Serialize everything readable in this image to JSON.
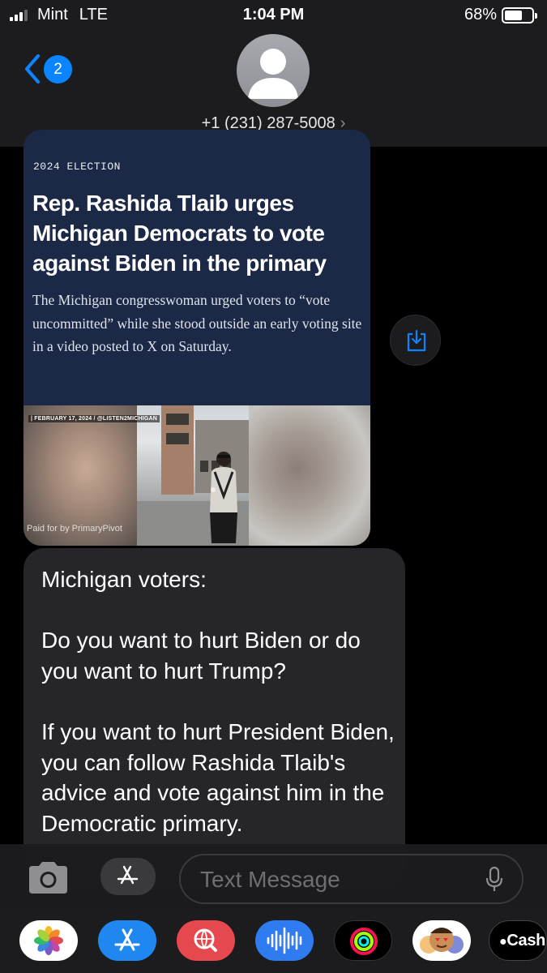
{
  "status_bar": {
    "carrier": "Mint",
    "network": "LTE",
    "time": "1:04 PM",
    "battery": "68%"
  },
  "nav": {
    "unread_count": "2",
    "contact": "+1 (231) 287-5008",
    "contact_chevron": "›"
  },
  "link_preview": {
    "kicker": "2024 ELECTION",
    "headline": "Rep. Rashida Tlaib urges Michigan Democrats to vote against Biden in the primary",
    "dek": "The Michigan congresswoman urged voters to “vote uncommitted” while she stood outside an early voting site in a video posted to X on Saturday.",
    "image_tag": "| FEBRUARY 17, 2024 / @LISTEN2MICHIGAN",
    "paid_for": "Paid for by PrimaryPivot"
  },
  "message": {
    "line1": "Michigan voters:",
    "line2": "Do you want to hurt Biden or do you want to hurt Trump?",
    "line3": "If you want to hurt President Biden, you can follow Rashida Tlaib's advice and vote against him in the Democratic primary."
  },
  "input": {
    "placeholder": "Text Message"
  },
  "app_drawer": {
    "apps": [
      "photos-icon",
      "app-store-icon",
      "web-search-icon",
      "audio-message-icon",
      "fitness-icon",
      "memoji-icon",
      "apple-cash-icon"
    ],
    "cash_label": "Cash"
  },
  "colors": {
    "accent": "#0a84ff",
    "bubble": "#26262a",
    "card_bg": "#1b2846"
  }
}
